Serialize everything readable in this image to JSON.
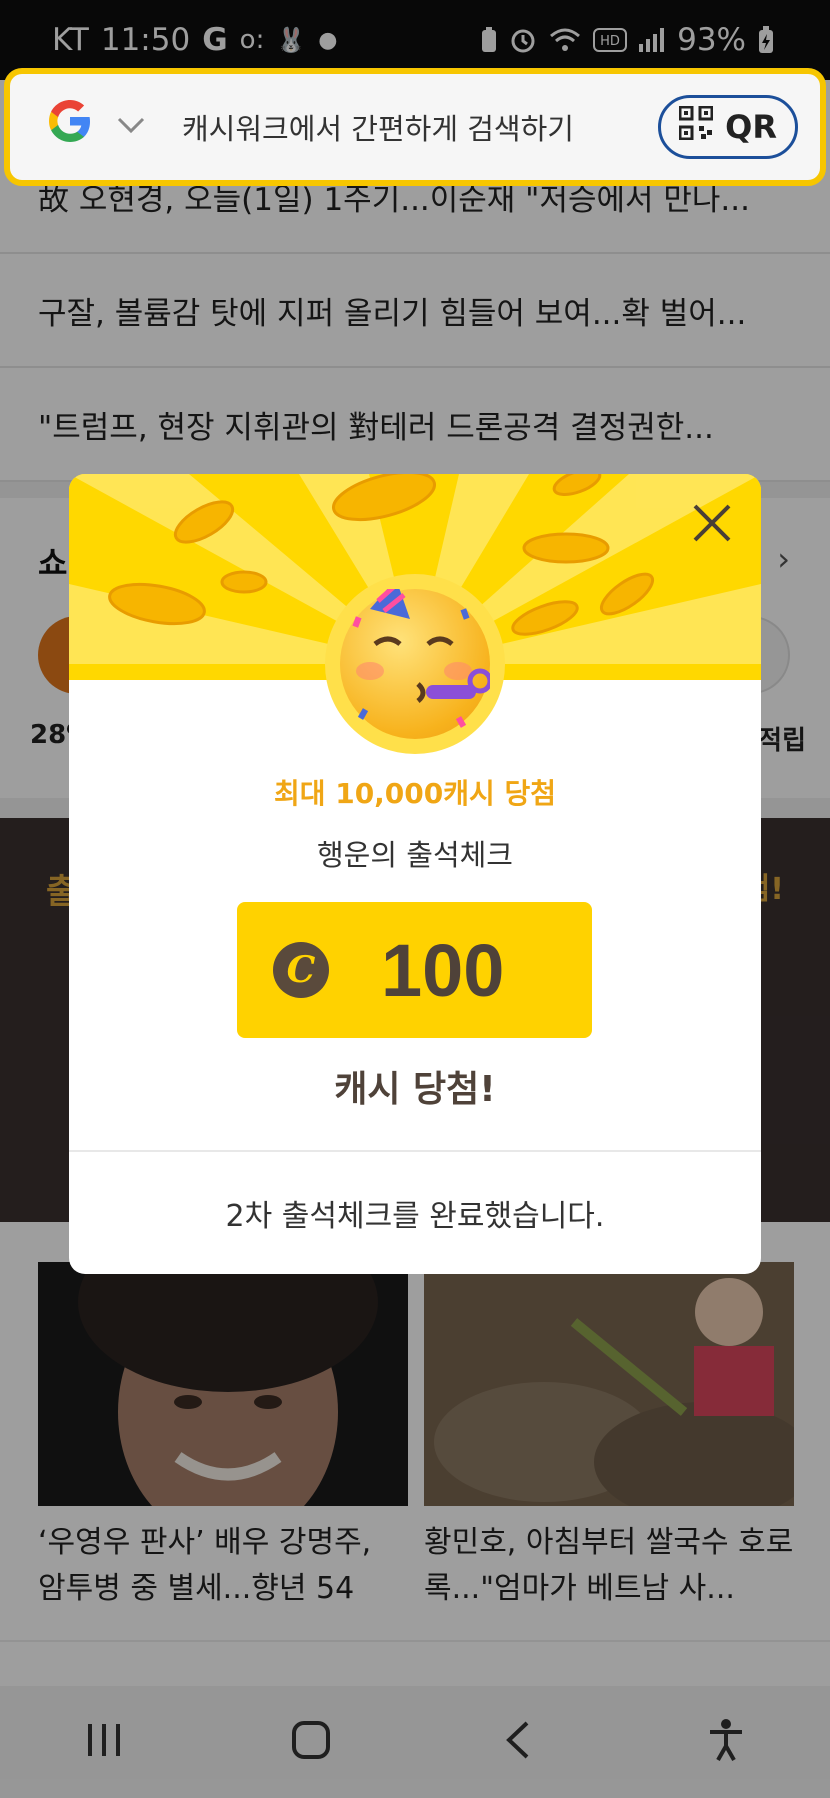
{
  "status_bar": {
    "carrier": "KT",
    "time": "11:50",
    "battery": "93%"
  },
  "search": {
    "placeholder": "캐시워크에서 간편하게 검색하기",
    "qr_label": "QR"
  },
  "news_list": [
    "故 오현경, 오늘(1일) 1주기...이순재 \"저승에서 만나...",
    "구잘, 볼륨감 탓에 지퍼 올리기 힘들어 보여...확 벌어...",
    "\"트럼프, 현장 지휘관의 對테러 드론공격 결정권한..."
  ],
  "shopping": {
    "title_partial": "쇼",
    "left_percent_partial": "28%",
    "right_label_partial": "적립"
  },
  "banner": {
    "left_partial": "출",
    "right_partial": "첨!"
  },
  "articles": [
    {
      "caption": "‘우영우 판사’ 배우 강명주, 암투병 중 별세...향년 54"
    },
    {
      "caption": "황민호, 아침부터 쌀국수 호로록...\"엄마가 베트남 사..."
    }
  ],
  "modal": {
    "headline": "최대 10,000캐시 당첨",
    "subtitle": "행운의 출석체크",
    "coin_symbol": "C",
    "amount": "100",
    "result": "캐시 당첨!",
    "footer": "2차 출석체크를 완료했습니다."
  },
  "colors": {
    "brand_yellow": "#ffd200",
    "accent_orange": "#f0a615",
    "dark_brown": "#4f4239",
    "qr_border": "#1c4f9a"
  }
}
